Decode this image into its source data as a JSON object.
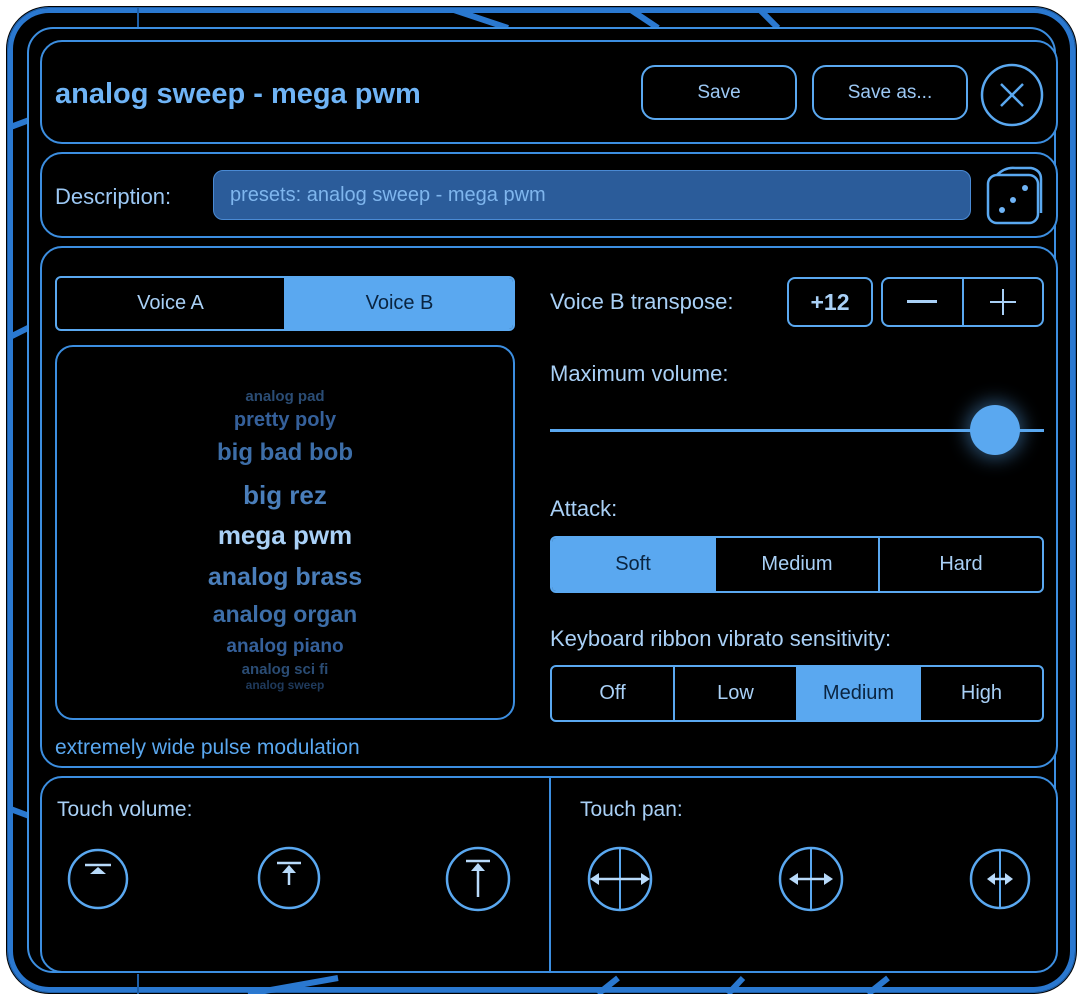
{
  "header": {
    "title": "analog sweep - mega pwm",
    "save_label": "Save",
    "save_as_label": "Save as...",
    "close_icon": "close-icon"
  },
  "description": {
    "label": "Description:",
    "value": "presets: analog sweep - mega pwm",
    "random_icon": "dice-icon"
  },
  "voices": {
    "tabs": [
      {
        "label": "Voice A",
        "selected": false
      },
      {
        "label": "Voice B",
        "selected": true
      }
    ],
    "picker_items": [
      "analog pad",
      "pretty poly",
      "big bad bob",
      "big rez",
      "mega pwm",
      "analog brass",
      "analog organ",
      "analog piano",
      "analog sci fi",
      "analog sweep"
    ],
    "selected_item": "mega pwm",
    "preset_description": "extremely wide pulse modulation"
  },
  "transpose": {
    "label": "Voice B transpose:",
    "value": "+12",
    "minus_icon": "minus-icon",
    "plus_icon": "plus-icon"
  },
  "max_volume": {
    "label": "Maximum volume:",
    "level": 0.9
  },
  "attack": {
    "label": "Attack:",
    "options": [
      "Soft",
      "Medium",
      "Hard"
    ],
    "selected": "Soft"
  },
  "vibrato": {
    "label": "Keyboard ribbon vibrato sensitivity:",
    "options": [
      "Off",
      "Low",
      "Medium",
      "High"
    ],
    "selected": "Medium"
  },
  "touch_volume": {
    "label": "Touch volume:",
    "icons": [
      "touch-volume-low-icon",
      "touch-volume-medium-icon",
      "touch-volume-high-icon"
    ]
  },
  "touch_pan": {
    "label": "Touch pan:",
    "icons": [
      "touch-pan-wide-icon",
      "touch-pan-medium-icon",
      "touch-pan-narrow-icon"
    ]
  },
  "colors": {
    "accent": "#5aa8f0",
    "border": "#3c8ee0",
    "background": "#000000"
  }
}
